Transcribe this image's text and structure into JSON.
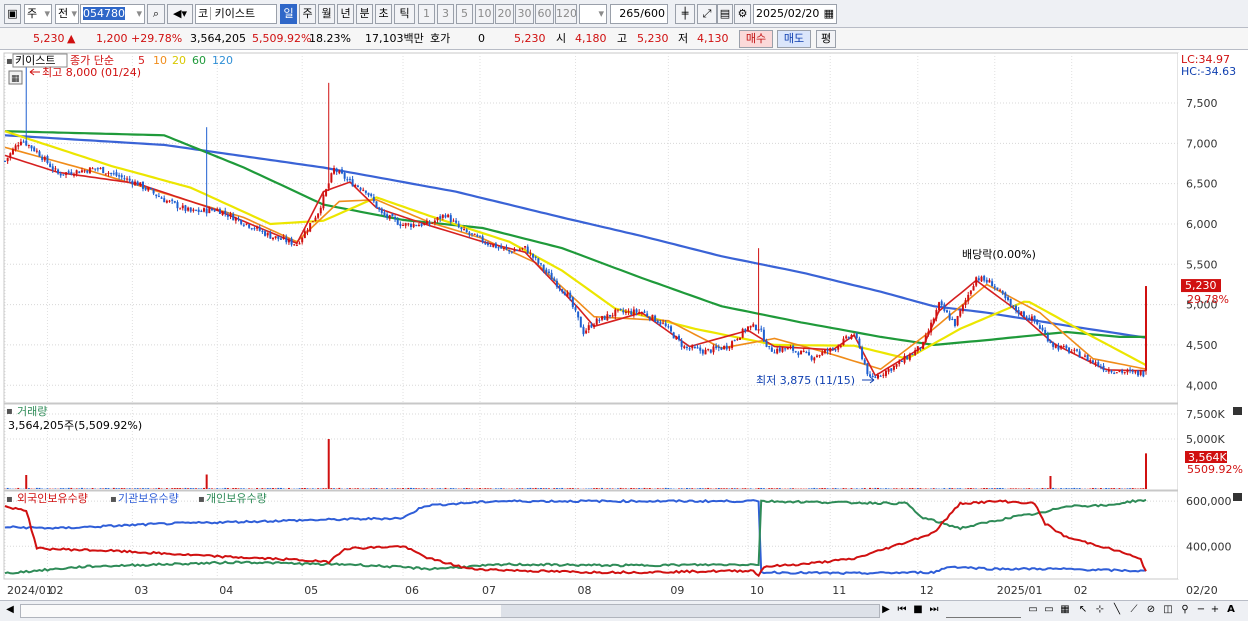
{
  "toolbar": {
    "market_short": "주",
    "mode_short": "전",
    "code": "054780",
    "market_code": "코",
    "stock_name": "키이스트",
    "periods": [
      "일",
      "주",
      "월",
      "년",
      "분",
      "초",
      "틱"
    ],
    "selected_period": "일",
    "intervals": [
      "1",
      "3",
      "5",
      "10",
      "20",
      "30",
      "60",
      "120"
    ],
    "count": "265",
    "count_max": "/600",
    "date": "2025/02/20"
  },
  "quote": {
    "price": "5,230",
    "change": "1,200",
    "change_pct": "+29.78%",
    "volume": "3,564,205",
    "volume_ratio": "5,509.92%",
    "turnover": "18.23%",
    "amount": "17,103백만",
    "hoga_label": "호가",
    "hoga_value": "0",
    "bid": "5,230",
    "open_label": "시",
    "open": "4,180",
    "high_label": "고",
    "high": "5,230",
    "low_label": "저",
    "low": "4,130",
    "buy_label": "매수",
    "sell_label": "매도",
    "eval_label": "평"
  },
  "chart_data": [
    {
      "type": "candlestick",
      "name": "price",
      "title": "키이스트",
      "legend": {
        "prefix": "종가 단순",
        "ma": [
          {
            "period": "5",
            "color": "#d62020"
          },
          {
            "period": "10",
            "color": "#f08c1a"
          },
          {
            "period": "20",
            "color": "#e6d800"
          },
          {
            "period": "60",
            "color": "#1f9a3a"
          },
          {
            "period": "120",
            "color": "#2f8fd6"
          }
        ]
      },
      "yticks": [
        4000,
        4500,
        5000,
        5500,
        6000,
        6500,
        7000,
        7500
      ],
      "ytick_labels": [
        "4,000",
        "4,500",
        "5,000",
        "5,500",
        "6,000",
        "6,500",
        "7,000",
        "7,500"
      ],
      "ylim": [
        3780,
        8120
      ],
      "lc_label": "LC:34.97",
      "hc_label": "HC:-34.63",
      "last_price_label": "5,230",
      "last_pct_label": "29.78%",
      "annotations": {
        "high": "최고 8,000 (01/24)",
        "low": "최저 3,875 (11/15)",
        "dividend": "배당락(0.00%)"
      },
      "anchors": [
        [
          0,
          6780
        ],
        [
          6,
          7050
        ],
        [
          12,
          6900
        ],
        [
          20,
          6620
        ],
        [
          35,
          6690
        ],
        [
          50,
          6500
        ],
        [
          60,
          6300
        ],
        [
          70,
          6150
        ],
        [
          80,
          6180
        ],
        [
          90,
          6020
        ],
        [
          100,
          5850
        ],
        [
          110,
          5750
        ],
        [
          118,
          6150
        ],
        [
          124,
          6680
        ],
        [
          130,
          6520
        ],
        [
          136,
          6420
        ],
        [
          142,
          6120
        ],
        [
          150,
          5990
        ],
        [
          160,
          6000
        ],
        [
          166,
          6120
        ],
        [
          172,
          5920
        ],
        [
          182,
          5760
        ],
        [
          190,
          5660
        ],
        [
          196,
          5700
        ],
        [
          204,
          5400
        ],
        [
          212,
          5120
        ],
        [
          218,
          4660
        ],
        [
          222,
          4780
        ],
        [
          230,
          4900
        ],
        [
          240,
          4910
        ],
        [
          248,
          4760
        ],
        [
          256,
          4470
        ],
        [
          264,
          4420
        ],
        [
          272,
          4480
        ],
        [
          280,
          4720
        ],
        [
          284,
          4720
        ],
        [
          288,
          4440
        ],
        [
          296,
          4450
        ],
        [
          304,
          4350
        ],
        [
          312,
          4450
        ],
        [
          320,
          4640
        ],
        [
          326,
          4070
        ],
        [
          336,
          4250
        ],
        [
          346,
          4500
        ],
        [
          352,
          5000
        ],
        [
          358,
          4760
        ],
        [
          366,
          5340
        ],
        [
          372,
          5260
        ],
        [
          380,
          4950
        ],
        [
          388,
          4800
        ],
        [
          395,
          4500
        ],
        [
          405,
          4380
        ],
        [
          415,
          4200
        ],
        [
          425,
          4150
        ],
        [
          430,
          4150
        ]
      ],
      "spikes": [
        {
          "i": 8,
          "high": 8000
        },
        {
          "i": 76,
          "high": 7200
        },
        {
          "i": 122,
          "high": 7750
        },
        {
          "i": 284,
          "high": 5700
        }
      ],
      "last_candle": {
        "open": 4180,
        "high": 5230,
        "low": 4130,
        "close": 5230
      },
      "ma5": [
        [
          0,
          6850
        ],
        [
          20,
          6640
        ],
        [
          50,
          6500
        ],
        [
          80,
          6170
        ],
        [
          110,
          5760
        ],
        [
          120,
          6400
        ],
        [
          130,
          6520
        ],
        [
          140,
          6200
        ],
        [
          160,
          5980
        ],
        [
          180,
          5780
        ],
        [
          196,
          5650
        ],
        [
          216,
          4960
        ],
        [
          222,
          4730
        ],
        [
          240,
          4900
        ],
        [
          258,
          4480
        ],
        [
          280,
          4680
        ],
        [
          290,
          4480
        ],
        [
          312,
          4440
        ],
        [
          320,
          4620
        ],
        [
          328,
          4120
        ],
        [
          346,
          4480
        ],
        [
          352,
          4920
        ],
        [
          366,
          5300
        ],
        [
          380,
          4960
        ],
        [
          395,
          4520
        ],
        [
          415,
          4190
        ],
        [
          430,
          4180
        ]
      ],
      "ma10": [
        [
          0,
          6950
        ],
        [
          30,
          6680
        ],
        [
          60,
          6380
        ],
        [
          90,
          6080
        ],
        [
          110,
          5780
        ],
        [
          126,
          6280
        ],
        [
          140,
          6300
        ],
        [
          160,
          6020
        ],
        [
          180,
          5820
        ],
        [
          200,
          5520
        ],
        [
          222,
          4850
        ],
        [
          250,
          4800
        ],
        [
          270,
          4460
        ],
        [
          290,
          4580
        ],
        [
          310,
          4400
        ],
        [
          330,
          4200
        ],
        [
          350,
          4700
        ],
        [
          370,
          5250
        ],
        [
          390,
          4900
        ],
        [
          410,
          4330
        ],
        [
          430,
          4200
        ]
      ],
      "ma20": [
        [
          0,
          7150
        ],
        [
          40,
          6720
        ],
        [
          70,
          6450
        ],
        [
          100,
          6000
        ],
        [
          120,
          6040
        ],
        [
          140,
          6330
        ],
        [
          160,
          6100
        ],
        [
          190,
          5780
        ],
        [
          210,
          5420
        ],
        [
          230,
          4950
        ],
        [
          260,
          4700
        ],
        [
          290,
          4500
        ],
        [
          320,
          4490
        ],
        [
          340,
          4330
        ],
        [
          360,
          4700
        ],
        [
          385,
          5050
        ],
        [
          410,
          4600
        ],
        [
          430,
          4250
        ]
      ],
      "ma60": [
        [
          0,
          7150
        ],
        [
          60,
          7100
        ],
        [
          90,
          6700
        ],
        [
          120,
          6240
        ],
        [
          150,
          6050
        ],
        [
          180,
          5950
        ],
        [
          210,
          5700
        ],
        [
          240,
          5330
        ],
        [
          270,
          4980
        ],
        [
          300,
          4780
        ],
        [
          330,
          4600
        ],
        [
          350,
          4500
        ],
        [
          370,
          4560
        ],
        [
          400,
          4660
        ],
        [
          420,
          4600
        ],
        [
          430,
          4600
        ]
      ],
      "ma120": [
        [
          0,
          7100
        ],
        [
          60,
          6980
        ],
        [
          120,
          6700
        ],
        [
          170,
          6400
        ],
        [
          210,
          6080
        ],
        [
          240,
          5850
        ],
        [
          270,
          5600
        ],
        [
          300,
          5400
        ],
        [
          330,
          5160
        ],
        [
          350,
          4980
        ],
        [
          370,
          4900
        ],
        [
          400,
          4740
        ],
        [
          430,
          4590
        ]
      ]
    },
    {
      "type": "bar",
      "name": "volume",
      "title": "거래량",
      "value_label": "3,564,205주(5,509.92%)",
      "yticks": [
        5000000,
        7500000
      ],
      "ytick_labels": [
        "5,000K",
        "7,500K"
      ],
      "ylim": [
        0,
        8500000
      ],
      "last_value_label": "3,564K",
      "last_pct_label": "5509.92%",
      "spikes": [
        {
          "i": 8,
          "v": 1400000
        },
        {
          "i": 76,
          "v": 1450000
        },
        {
          "i": 122,
          "v": 5000000
        },
        {
          "i": 394,
          "v": 1300000
        },
        {
          "i": 430,
          "v": 3564205
        }
      ]
    },
    {
      "type": "line",
      "name": "holdings",
      "legend": [
        {
          "name": "외국인보유수량",
          "color": "#d01010"
        },
        {
          "name": "기관보유수량",
          "color": "#2f5ed8"
        },
        {
          "name": "개인보유수량",
          "color": "#2e8b57"
        }
      ],
      "yticks": [
        400000,
        600000
      ],
      "ytick_labels": [
        "400,000",
        "600,000"
      ],
      "ylim": [
        255000,
        645000
      ],
      "foreign": [
        [
          0,
          575000
        ],
        [
          8,
          560000
        ],
        [
          12,
          390000
        ],
        [
          40,
          380000
        ],
        [
          80,
          355000
        ],
        [
          110,
          340000
        ],
        [
          122,
          330000
        ],
        [
          128,
          390000
        ],
        [
          150,
          400000
        ],
        [
          160,
          345000
        ],
        [
          175,
          300000
        ],
        [
          200,
          290000
        ],
        [
          220,
          285000
        ],
        [
          240,
          285000
        ],
        [
          270,
          290000
        ],
        [
          282,
          292000
        ],
        [
          284,
          270000
        ],
        [
          286,
          310000
        ],
        [
          300,
          320000
        ],
        [
          320,
          345000
        ],
        [
          340,
          420000
        ],
        [
          350,
          460000
        ],
        [
          360,
          590000
        ],
        [
          375,
          600000
        ],
        [
          388,
          590000
        ],
        [
          392,
          500000
        ],
        [
          400,
          440000
        ],
        [
          410,
          410000
        ],
        [
          422,
          370000
        ],
        [
          428,
          340000
        ],
        [
          430,
          290000
        ]
      ],
      "institution": [
        [
          0,
          485000
        ],
        [
          20,
          480000
        ],
        [
          60,
          500000
        ],
        [
          110,
          515000
        ],
        [
          150,
          525000
        ],
        [
          158,
          580000
        ],
        [
          185,
          600000
        ],
        [
          230,
          600000
        ],
        [
          284,
          600000
        ],
        [
          285,
          285000
        ],
        [
          320,
          280000
        ],
        [
          350,
          285000
        ],
        [
          356,
          310000
        ],
        [
          372,
          300000
        ],
        [
          395,
          300000
        ],
        [
          430,
          290000
        ]
      ],
      "individual": [
        [
          0,
          280000
        ],
        [
          30,
          310000
        ],
        [
          60,
          320000
        ],
        [
          90,
          330000
        ],
        [
          120,
          320000
        ],
        [
          130,
          320000
        ],
        [
          160,
          300000
        ],
        [
          190,
          320000
        ],
        [
          230,
          315000
        ],
        [
          284,
          320000
        ],
        [
          285,
          600000
        ],
        [
          310,
          595000
        ],
        [
          340,
          590000
        ],
        [
          345,
          530000
        ],
        [
          360,
          480000
        ],
        [
          380,
          530000
        ],
        [
          392,
          550000
        ],
        [
          400,
          580000
        ],
        [
          415,
          580000
        ],
        [
          425,
          600000
        ],
        [
          430,
          605000
        ]
      ]
    }
  ],
  "xaxis": {
    "labels": [
      "2024/01",
      "02",
      "03",
      "04",
      "05",
      "06",
      "07",
      "08",
      "09",
      "10",
      "11",
      "12",
      "2025/01",
      "02",
      "02/20"
    ],
    "positions": [
      0,
      16,
      48,
      80,
      112,
      150,
      179,
      215,
      250,
      280,
      311,
      344,
      373,
      402,
      430
    ]
  }
}
